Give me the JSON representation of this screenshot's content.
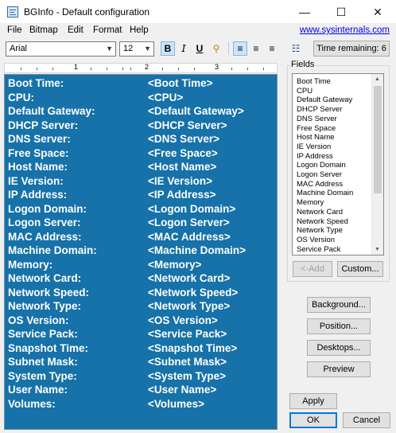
{
  "window": {
    "title": "BGInfo - Default configuration",
    "minimize": "—",
    "maximize": "☐",
    "close": "✕"
  },
  "menu": {
    "items": [
      "File",
      "Bitmap",
      "Edit",
      "Format",
      "Help"
    ],
    "link": "www.sysinternals.com"
  },
  "toolbar": {
    "font": "Arial",
    "size": "12",
    "bold": "B",
    "italic": "𝘐",
    "underline": "U",
    "find": "⚲",
    "align_left": "≡",
    "align_center": "≡",
    "align_right": "≡",
    "bullets": "☷",
    "time_remaining": "Time remaining: 6"
  },
  "ruler": {
    "numbers": [
      "1",
      "2",
      "3"
    ]
  },
  "editor": {
    "rows": [
      {
        "label": "Boot Time:",
        "value": "<Boot Time>"
      },
      {
        "label": "CPU:",
        "value": "<CPU>"
      },
      {
        "label": "Default Gateway:",
        "value": "<Default Gateway>"
      },
      {
        "label": "DHCP Server:",
        "value": "<DHCP Server>"
      },
      {
        "label": "DNS Server:",
        "value": "<DNS Server>"
      },
      {
        "label": "Free Space:",
        "value": "<Free Space>"
      },
      {
        "label": "Host Name:",
        "value": "<Host Name>"
      },
      {
        "label": "IE Version:",
        "value": "<IE Version>"
      },
      {
        "label": "IP Address:",
        "value": "<IP Address>"
      },
      {
        "label": "Logon Domain:",
        "value": "<Logon Domain>"
      },
      {
        "label": "Logon Server:",
        "value": "<Logon Server>"
      },
      {
        "label": "MAC Address:",
        "value": "<MAC Address>"
      },
      {
        "label": "Machine Domain:",
        "value": "<Machine Domain>"
      },
      {
        "label": "Memory:",
        "value": "<Memory>"
      },
      {
        "label": "Network Card:",
        "value": "<Network Card>"
      },
      {
        "label": "Network Speed:",
        "value": "<Network Speed>"
      },
      {
        "label": "Network Type:",
        "value": "<Network Type>"
      },
      {
        "label": "OS Version:",
        "value": "<OS Version>"
      },
      {
        "label": "Service Pack:",
        "value": "<Service Pack>"
      },
      {
        "label": "Snapshot Time:",
        "value": "<Snapshot Time>"
      },
      {
        "label": "Subnet Mask:",
        "value": "<Subnet Mask>"
      },
      {
        "label": "System Type:",
        "value": "<System Type>"
      },
      {
        "label": "User Name:",
        "value": "<User Name>"
      },
      {
        "label": "Volumes:",
        "value": "<Volumes>"
      }
    ]
  },
  "fields": {
    "label": "Fields",
    "items": [
      "Boot Time",
      "CPU",
      "Default Gateway",
      "DHCP Server",
      "DNS Server",
      "Free Space",
      "Host Name",
      "IE Version",
      "IP Address",
      "Logon Domain",
      "Logon Server",
      "MAC Address",
      "Machine Domain",
      "Memory",
      "Network Card",
      "Network Speed",
      "Network Type",
      "OS Version",
      "Service Pack"
    ],
    "add": "<-Add",
    "custom": "Custom..."
  },
  "buttons": {
    "background": "Background...",
    "position": "Position...",
    "desktops": "Desktops...",
    "preview": "Preview",
    "apply": "Apply",
    "ok": "OK",
    "cancel": "Cancel"
  },
  "colors": {
    "editor_bg": "#1672a8",
    "accent": "#0078d7"
  }
}
